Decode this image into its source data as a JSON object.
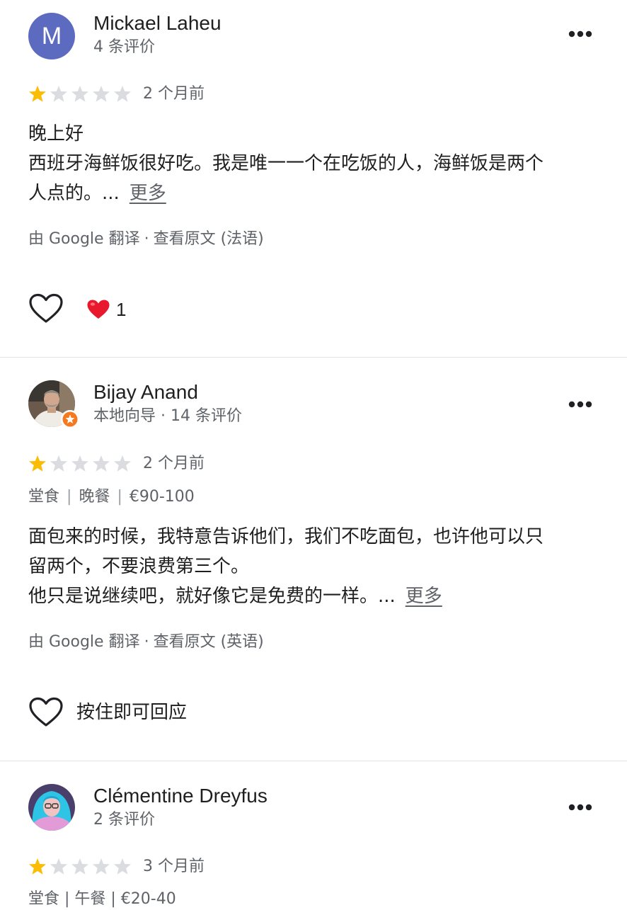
{
  "reviews": [
    {
      "author": "Mickael Laheu",
      "avatar_letter": "M",
      "avatar_color": "#5c6bc0",
      "meta": "4 条评价",
      "rating": 1,
      "max_rating": 5,
      "time": "2 个月前",
      "text_lines": [
        "晚上好",
        "西班牙海鲜饭很好吃。我是唯一一个在吃饭的人，海鲜饭是两个",
        "人点的。..."
      ],
      "more_label": "更多",
      "translation_note": "由 Google 翻译",
      "view_original": "查看原文 (法语)",
      "like_icon": "heart-outline-icon",
      "reaction_icon": "red-heart-emoji",
      "reaction_count": "1"
    },
    {
      "author": "Bijay Anand",
      "avatar_icon": "profile-photo",
      "badge_icon": "local-guide-badge-icon",
      "meta": "本地向导 · 14 条评价",
      "rating": 1,
      "max_rating": 5,
      "time": "2 个月前",
      "service": [
        "堂食",
        "晚餐",
        "€90-100"
      ],
      "text_lines": [
        "面包来的时候，我特意告诉他们，我们不吃面包，也许他可以只",
        "留两个，不要浪费第三个。",
        "他只是说继续吧，就好像它是免费的一样。..."
      ],
      "more_label": "更多",
      "translation_note": "由 Google 翻译",
      "view_original": "查看原文 (英语)",
      "like_icon": "heart-outline-icon",
      "hold_to_reply": "按住即可回应"
    },
    {
      "author": "Clémentine Dreyfus",
      "avatar_icon": "profile-photo",
      "meta": "2 条评价",
      "rating": 1,
      "max_rating": 5,
      "time": "3 个月前",
      "service_partial": "堂食 | 午餐 | €20-40"
    }
  ],
  "colors": {
    "star_filled": "#fbbc04",
    "star_empty": "#dadce0",
    "secondary_text": "#5f6368",
    "divider": "#e3e3e3",
    "heart_red": "#e8192c"
  }
}
